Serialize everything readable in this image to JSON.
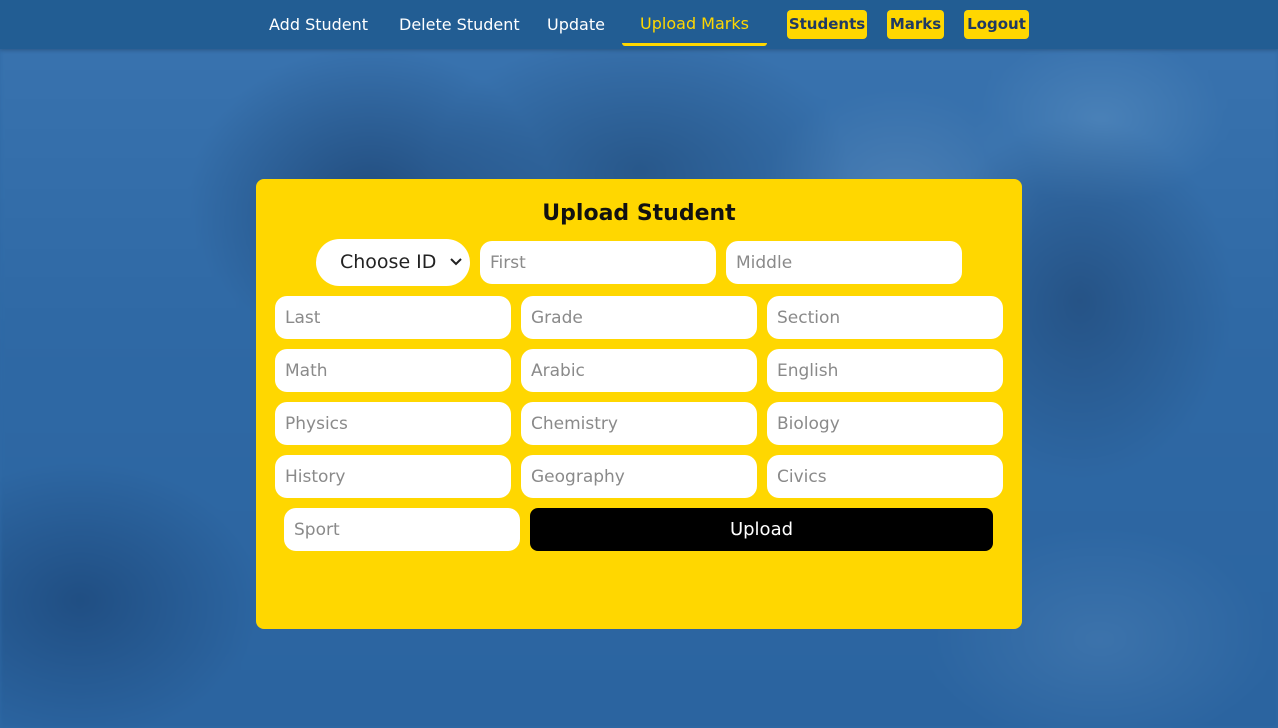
{
  "nav": {
    "links": [
      "Add Student",
      "Delete Student",
      "Update",
      "Upload Marks"
    ],
    "buttons": [
      "Students",
      "Marks",
      "Logout"
    ]
  },
  "form": {
    "title": "Upload Student",
    "id_select": "Choose ID",
    "placeholders": {
      "first": "First",
      "middle": "Middle",
      "last": "Last",
      "grade": "Grade",
      "section": "Section",
      "math": "Math",
      "arabic": "Arabic",
      "english": "English",
      "physics": "Physics",
      "chemistry": "Chemistry",
      "biology": "Biology",
      "history": "History",
      "geography": "Geography",
      "civics": "Civics",
      "sport": "Sport"
    },
    "submit_label": "Upload"
  },
  "colors": {
    "accent": "#ffd700",
    "navbar": "#225d93",
    "button_dark": "#000000"
  }
}
